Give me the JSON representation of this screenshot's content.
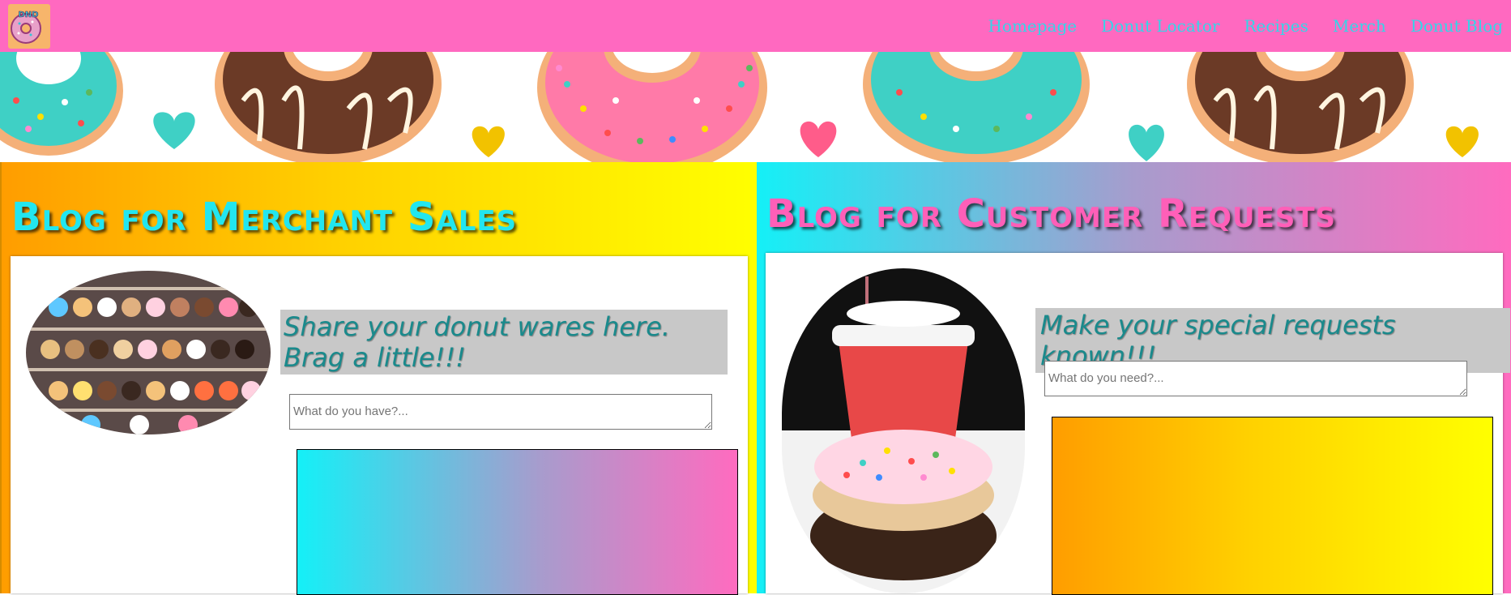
{
  "header": {
    "logo_text": "DND",
    "nav": [
      {
        "label": "Homepage"
      },
      {
        "label": "Donut Locator"
      },
      {
        "label": "Recipes"
      },
      {
        "label": "Merch"
      },
      {
        "label": "Donut Blog"
      }
    ]
  },
  "colors": {
    "nav_bg": "#ff69c0",
    "nav_link": "#33d6e8",
    "orange_gradient": [
      "#ff9d00",
      "#ffff00"
    ],
    "cyan_pink_gradient": [
      "#14f0f7",
      "#ff6bbf"
    ],
    "prompt_text": "#1a8a8c",
    "prompt_bg": "#c8c8c8"
  },
  "merchant": {
    "title": "Blog for Merchant Sales",
    "prompt": "Share your donut wares here. Brag a little!!!",
    "input_placeholder": "What do you have?..."
  },
  "customer": {
    "title": "Blog for Customer Requests",
    "prompt": "Make your special requests known!!!",
    "input_placeholder": "What do you need?..."
  }
}
